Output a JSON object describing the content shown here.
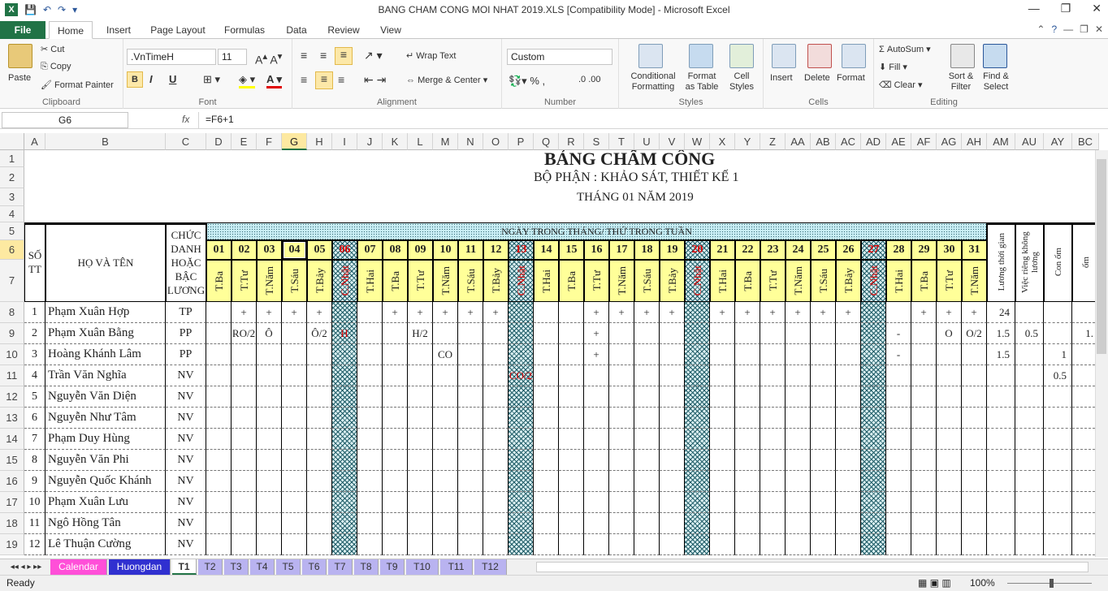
{
  "window": {
    "title": "BANG CHAM CONG MOI NHAT 2019.XLS  [Compatibility Mode]  -  Microsoft Excel",
    "minimize": "—",
    "restore": "❐",
    "close": "✕"
  },
  "ribbon_tabs": [
    "File",
    "Home",
    "Insert",
    "Page Layout",
    "Formulas",
    "Data",
    "Review",
    "View"
  ],
  "ribbon": {
    "clipboard": {
      "paste": "Paste",
      "cut": "Cut",
      "copy": "Copy",
      "painter": "Format Painter",
      "label": "Clipboard"
    },
    "font": {
      "name": ".VnTimeH",
      "size": "11",
      "bold": "B",
      "italic": "I",
      "underline": "U",
      "label": "Font"
    },
    "alignment": {
      "wrap": "Wrap Text",
      "merge": "Merge & Center",
      "label": "Alignment"
    },
    "number": {
      "format": "Custom",
      "label": "Number"
    },
    "styles": {
      "conditional": "Conditional Formatting",
      "table": "Format as Table",
      "cell": "Cell Styles",
      "label": "Styles"
    },
    "cells": {
      "insert": "Insert",
      "delete": "Delete",
      "format": "Format",
      "label": "Cells"
    },
    "editing": {
      "autosum": "AutoSum",
      "fill": "Fill",
      "clear": "Clear",
      "sort": "Sort & Filter",
      "find": "Find & Select",
      "label": "Editing"
    }
  },
  "formula_bar": {
    "namebox": "G6",
    "fx": "fx",
    "formula": "=F6+1"
  },
  "columns": [
    "A",
    "B",
    "C",
    "D",
    "E",
    "F",
    "G",
    "H",
    "I",
    "J",
    "K",
    "L",
    "M",
    "N",
    "O",
    "P",
    "Q",
    "R",
    "S",
    "T",
    "U",
    "V",
    "W",
    "X",
    "Y",
    "Z",
    "AA",
    "AB",
    "AC",
    "AD",
    "AE",
    "AF",
    "AG",
    "AH",
    "AM",
    "AU",
    "AY",
    "BC"
  ],
  "active_col": "G",
  "active_row": "6",
  "sheet": {
    "title": "BẢNG CHẤM CÔNG",
    "dept": "BỘ PHẬN : KHẢO SÁT, THIẾT KẾ 1",
    "month": "THÁNG 01 NĂM 2019",
    "h_stt": "SỐ TT",
    "h_name": "HỌ VÀ TÊN",
    "h_title": "CHỨC DANH HOẶC BẬC LƯƠNG",
    "h_days": "NGÀY TRONG THÁNG/ THỨ TRONG TUẦN",
    "h_extra": [
      "Lương thời gian",
      "Việc riêng không lương",
      "Con ốm",
      "ốm"
    ],
    "days": [
      "01",
      "02",
      "03",
      "04",
      "05",
      "06",
      "07",
      "08",
      "09",
      "10",
      "11",
      "12",
      "13",
      "14",
      "15",
      "16",
      "17",
      "18",
      "19",
      "20",
      "21",
      "22",
      "23",
      "24",
      "25",
      "26",
      "27",
      "28",
      "29",
      "30",
      "31"
    ],
    "weekdays": [
      "T.Ba",
      "T.Tư",
      "T.Năm",
      "T.Sáu",
      "T.Bảy",
      "C.Nhật",
      "T.Hai",
      "T.Ba",
      "T.Tư",
      "T.Năm",
      "T.Sáu",
      "T.Bảy",
      "C.Nhật",
      "T.Hai",
      "T.Ba",
      "T.Tư",
      "T.Năm",
      "T.Sáu",
      "T.Bảy",
      "C.Nhật",
      "T.Hai",
      "T.Ba",
      "T.Tư",
      "T.Năm",
      "T.Sáu",
      "T.Bảy",
      "C.Nhật",
      "T.Hai",
      "T.Ba",
      "T.Tư",
      "T.Năm"
    ],
    "employees": [
      {
        "stt": "1",
        "name": "Phạm Xuân Hợp",
        "title": "TP",
        "marks": {
          "02": "+",
          "03": "+",
          "04": "+",
          "05": "+",
          "08": "+",
          "09": "+",
          "10": "+",
          "11": "+",
          "12": "+",
          "16": "+",
          "17": "+",
          "18": "+",
          "19": "+",
          "21": "+",
          "22": "+",
          "23": "+",
          "24": "+",
          "25": "+",
          "26": "+",
          "29": "+",
          "30": "+",
          "31": "+"
        },
        "extra": [
          "24",
          "",
          "",
          ""
        ]
      },
      {
        "stt": "2",
        "name": "Phạm Xuân Bằng",
        "title": "PP",
        "marks": {
          "02": "RO/2",
          "03": "Ô",
          "05": "Ô/2",
          "06": "H",
          "09": "H/2",
          "16": "+",
          "28": "-",
          "30": "O",
          "31": "O/2"
        },
        "extra": [
          "1.5",
          "0.5",
          "",
          "1."
        ]
      },
      {
        "stt": "3",
        "name": "Hoàng Khánh Lâm",
        "title": "PP",
        "marks": {
          "10": "CO",
          "16": "+",
          "28": "-"
        },
        "extra": [
          "1.5",
          "",
          "1",
          ""
        ]
      },
      {
        "stt": "4",
        "name": "Trần Văn Nghĩa",
        "title": "NV",
        "marks": {
          "13": "CO/2"
        },
        "extra": [
          "",
          "",
          "0.5",
          ""
        ]
      },
      {
        "stt": "5",
        "name": "Nguyễn Văn Diện",
        "title": "NV",
        "marks": {},
        "extra": [
          "",
          "",
          "",
          ""
        ]
      },
      {
        "stt": "6",
        "name": "Nguyễn Như Tâm",
        "title": "NV",
        "marks": {},
        "extra": [
          "",
          "",
          "",
          ""
        ]
      },
      {
        "stt": "7",
        "name": "Phạm Duy Hùng",
        "title": "NV",
        "marks": {},
        "extra": [
          "",
          "",
          "",
          ""
        ]
      },
      {
        "stt": "8",
        "name": "Nguyễn Văn Phi",
        "title": "NV",
        "marks": {},
        "extra": [
          "",
          "",
          "",
          ""
        ]
      },
      {
        "stt": "9",
        "name": "Nguyễn Quốc Khánh",
        "title": "NV",
        "marks": {},
        "extra": [
          "",
          "",
          "",
          ""
        ]
      },
      {
        "stt": "10",
        "name": "Phạm Xuân Lưu",
        "title": "NV",
        "marks": {},
        "extra": [
          "",
          "",
          "",
          ""
        ]
      },
      {
        "stt": "11",
        "name": "Ngô Hồng Tân",
        "title": "NV",
        "marks": {},
        "extra": [
          "",
          "",
          "",
          ""
        ]
      },
      {
        "stt": "12",
        "name": "Lê Thuận Cường",
        "title": "NV",
        "marks": {},
        "extra": [
          "",
          "",
          "",
          ""
        ]
      }
    ]
  },
  "sheet_tabs": [
    "Calendar",
    "Huongdan",
    "T1",
    "T2",
    "T3",
    "T4",
    "T5",
    "T6",
    "T7",
    "T8",
    "T9",
    "T10",
    "T11",
    "T12"
  ],
  "active_sheet": "T1",
  "status": {
    "ready": "Ready",
    "zoom": "100%"
  },
  "colors": {
    "accent": "#217346",
    "sunday_red": "#e00000",
    "header_yellow": "#ffff99"
  }
}
